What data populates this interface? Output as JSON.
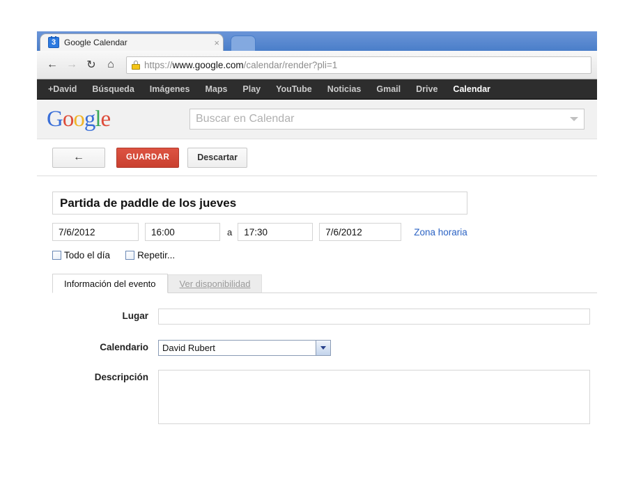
{
  "browser": {
    "tab": {
      "title": "Google Calendar",
      "favicon_label": "3",
      "close_label": "×"
    },
    "nav": {
      "back_icon": "←",
      "forward_icon": "→",
      "reload_icon": "↻",
      "home_icon": "⌂"
    },
    "url": {
      "scheme": "https://",
      "host": "www.google.com",
      "path": "/calendar/render?pli=1"
    }
  },
  "gbar": {
    "items": [
      {
        "label": "+David",
        "active": false
      },
      {
        "label": "Búsqueda",
        "active": false
      },
      {
        "label": "Imágenes",
        "active": false
      },
      {
        "label": "Maps",
        "active": false
      },
      {
        "label": "Play",
        "active": false
      },
      {
        "label": "YouTube",
        "active": false
      },
      {
        "label": "Noticias",
        "active": false
      },
      {
        "label": "Gmail",
        "active": false
      },
      {
        "label": "Drive",
        "active": false
      },
      {
        "label": "Calendar",
        "active": true
      }
    ]
  },
  "header": {
    "logo": {
      "g1": "G",
      "o1": "o",
      "o2": "o",
      "g2": "g",
      "l": "l",
      "e": "e"
    },
    "search_placeholder": "Buscar en Calendar"
  },
  "toolbar": {
    "back_label": "←",
    "save_label": "GUARDAR",
    "discard_label": "Descartar"
  },
  "event": {
    "title": "Partida de paddle de los jueves",
    "start_date": "7/6/2012",
    "start_time": "16:00",
    "separator": "a",
    "end_time": "17:30",
    "end_date": "7/6/2012",
    "timezone_link": "Zona horaria",
    "all_day_label": "Todo el día",
    "repeat_label": "Repetir...",
    "all_day_checked": false,
    "repeat_checked": false
  },
  "tabs": [
    {
      "label": "Información del evento",
      "active": true
    },
    {
      "label": "Ver disponibilidad",
      "active": false
    }
  ],
  "fields": {
    "place_label": "Lugar",
    "place_value": "",
    "calendar_label": "Calendario",
    "calendar_value": "David Rubert",
    "description_label": "Descripción",
    "description_value": ""
  },
  "colors": {
    "save_red": "#d14836",
    "link_blue": "#2b63c4",
    "gbar_dark": "#2d2d2d"
  }
}
